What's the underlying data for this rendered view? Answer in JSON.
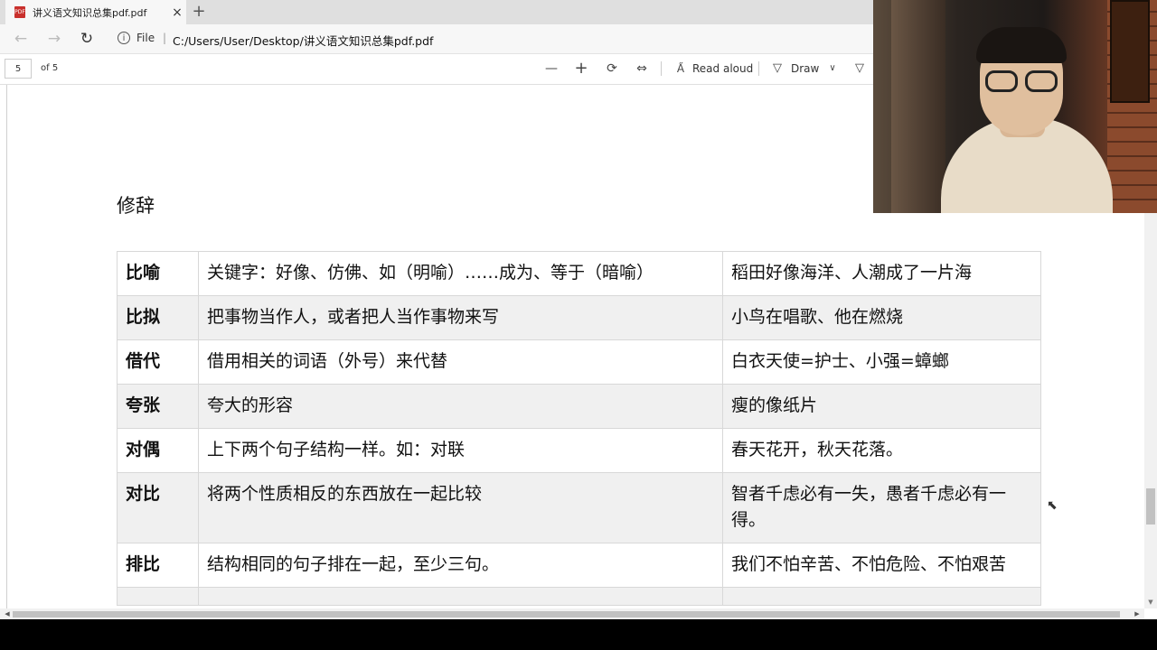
{
  "browser": {
    "tab_title": "讲义语文知识总集pdf.pdf",
    "tab_close": "×",
    "new_tab": "+",
    "file_label": "File",
    "separator": "|",
    "url": "C:/Users/User/Desktop/讲义语文知识总集pdf.pdf"
  },
  "pdf_toolbar": {
    "page_number": "5",
    "page_of": "of 5",
    "read_aloud_label": "Read aloud",
    "draw_label": "Draw"
  },
  "document": {
    "heading": "修辞",
    "table": [
      {
        "term": "比喻",
        "description": "关键字：好像、仿佛、如（明喻）……成为、等于（暗喻）",
        "example": "稻田好像海洋、人潮成了一片海"
      },
      {
        "term": "比拟",
        "description": "把事物当作人，或者把人当作事物来写",
        "example": "小鸟在唱歌、他在燃烧"
      },
      {
        "term": "借代",
        "description": "借用相关的词语（外号）来代替",
        "example": "白衣天使=护士、小强=蟑螂"
      },
      {
        "term": "夸张",
        "description": "夸大的形容",
        "example": "瘦的像纸片"
      },
      {
        "term": "对偶",
        "description": "上下两个句子结构一样。如：对联",
        "example": "春天花开，秋天花落。"
      },
      {
        "term": "对比",
        "description": "将两个性质相反的东西放在一起比较",
        "example": "智者千虑必有一失，愚者千虑必有一得。"
      },
      {
        "term": "排比",
        "description": "结构相同的句子排在一起，至少三句。",
        "example": "我们不怕辛苦、不怕危险、不怕艰苦"
      },
      {
        "term": "",
        "description": "",
        "example": ""
      }
    ]
  },
  "icons": {
    "back": "back-arrow-icon",
    "forward": "forward-arrow-icon",
    "refresh": "refresh-icon",
    "info": "info-icon",
    "zoom_out": "minus-icon",
    "zoom_in": "plus-icon",
    "rotate": "rotate-icon",
    "fit": "fit-page-icon",
    "read_aloud": "read-aloud-icon",
    "draw": "draw-pen-icon",
    "highlight": "highlight-icon"
  }
}
